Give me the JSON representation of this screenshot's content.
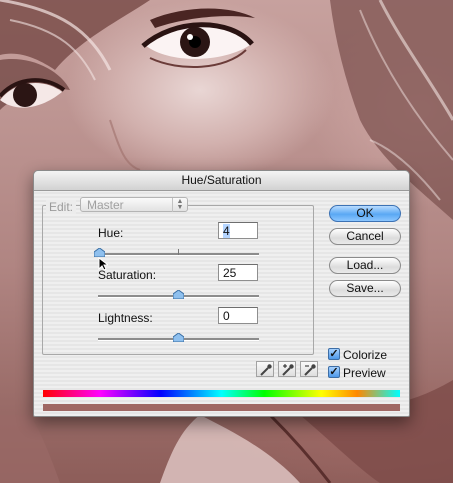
{
  "dialog": {
    "title": "Hue/Saturation",
    "edit_label": "Edit:",
    "edit_value": "Master",
    "hue": {
      "label": "Hue:",
      "value": "4",
      "level": 0.011
    },
    "saturation": {
      "label": "Saturation:",
      "value": "25",
      "level": 0.5
    },
    "lightness": {
      "label": "Lightness:",
      "value": "0",
      "level": 0.5
    },
    "buttons": {
      "ok": "OK",
      "cancel": "Cancel",
      "load": "Load...",
      "save": "Save..."
    },
    "checkboxes": {
      "colorize": {
        "label": "Colorize",
        "checked": true
      },
      "preview": {
        "label": "Preview",
        "checked": true
      }
    },
    "eyedroppers": [
      "eyedropper-icon",
      "eyedropper-plus-icon",
      "eyedropper-minus-icon"
    ],
    "result_color": "#a06864",
    "accent_color": "#5aa8f4"
  }
}
